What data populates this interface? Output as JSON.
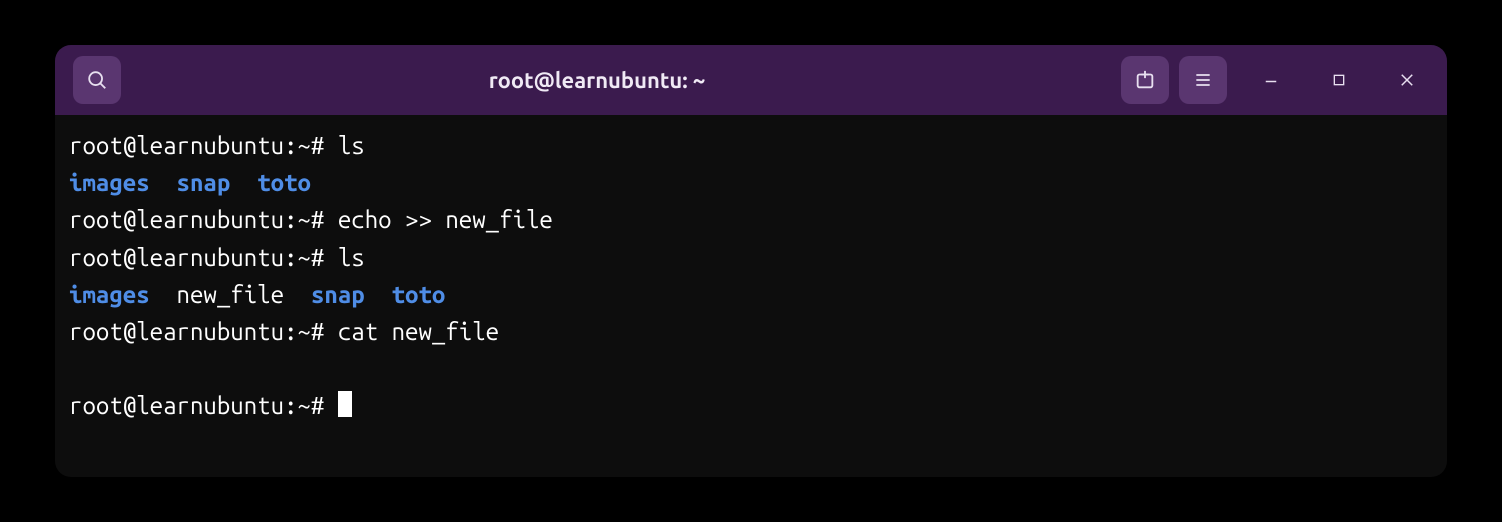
{
  "window": {
    "title": "root@learnubuntu: ~"
  },
  "colors": {
    "titlebar_bg": "#3b1b4e",
    "button_bg": "#5a3670",
    "terminal_bg": "#0d0d0d",
    "text": "#ffffff",
    "directory": "#4f8de6"
  },
  "prompt": "root@learnubuntu:~#",
  "lines": [
    {
      "type": "cmd",
      "prompt": "root@learnubuntu:~#",
      "command": "ls"
    },
    {
      "type": "ls",
      "entries": [
        {
          "name": "images",
          "kind": "dir"
        },
        {
          "name": "snap",
          "kind": "dir"
        },
        {
          "name": "toto",
          "kind": "dir"
        }
      ]
    },
    {
      "type": "cmd",
      "prompt": "root@learnubuntu:~#",
      "command": "echo >> new_file"
    },
    {
      "type": "cmd",
      "prompt": "root@learnubuntu:~#",
      "command": "ls"
    },
    {
      "type": "ls",
      "entries": [
        {
          "name": "images",
          "kind": "dir"
        },
        {
          "name": "new_file",
          "kind": "file"
        },
        {
          "name": "snap",
          "kind": "dir"
        },
        {
          "name": "toto",
          "kind": "dir"
        }
      ]
    },
    {
      "type": "cmd",
      "prompt": "root@learnubuntu:~#",
      "command": "cat new_file"
    },
    {
      "type": "blank"
    },
    {
      "type": "cmd",
      "prompt": "root@learnubuntu:~#",
      "command": "",
      "cursor": true
    }
  ]
}
